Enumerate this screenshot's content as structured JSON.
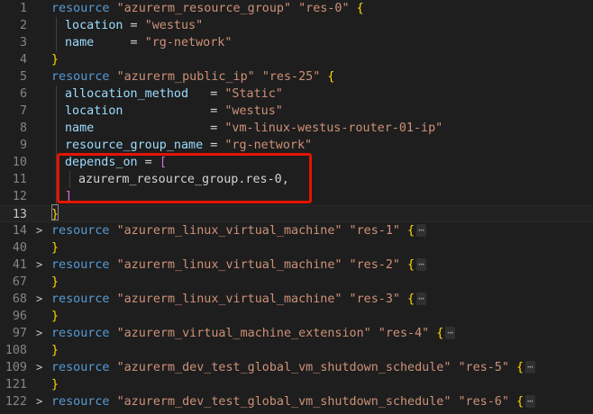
{
  "editor": {
    "language": "hcl",
    "active_line": "13",
    "fold_ellipsis": "⋯",
    "lines": [
      {
        "num": "1",
        "indent": 0,
        "fold": "",
        "tokens": [
          {
            "t": "resource",
            "c": "kw"
          },
          {
            "t": " ",
            "c": "plain"
          },
          {
            "t": "\"azurerm_resource_group\"",
            "c": "str"
          },
          {
            "t": " ",
            "c": "plain"
          },
          {
            "t": "\"res-0\"",
            "c": "str"
          },
          {
            "t": " ",
            "c": "plain"
          },
          {
            "t": "{",
            "c": "brace"
          }
        ]
      },
      {
        "num": "2",
        "indent": 1,
        "fold": "",
        "tokens": [
          {
            "t": "location",
            "c": "attr"
          },
          {
            "t": " = ",
            "c": "plain"
          },
          {
            "t": "\"westus\"",
            "c": "str"
          }
        ]
      },
      {
        "num": "3",
        "indent": 1,
        "fold": "",
        "tokens": [
          {
            "t": "name",
            "c": "attr"
          },
          {
            "t": "     = ",
            "c": "plain"
          },
          {
            "t": "\"rg-network\"",
            "c": "str"
          }
        ]
      },
      {
        "num": "4",
        "indent": 0,
        "fold": "",
        "tokens": [
          {
            "t": "}",
            "c": "brace"
          }
        ]
      },
      {
        "num": "5",
        "indent": 0,
        "fold": "",
        "tokens": [
          {
            "t": "resource",
            "c": "kw"
          },
          {
            "t": " ",
            "c": "plain"
          },
          {
            "t": "\"azurerm_public_ip\"",
            "c": "str"
          },
          {
            "t": " ",
            "c": "plain"
          },
          {
            "t": "\"res-25\"",
            "c": "str"
          },
          {
            "t": " ",
            "c": "plain"
          },
          {
            "t": "{",
            "c": "brace"
          }
        ]
      },
      {
        "num": "6",
        "indent": 1,
        "fold": "",
        "tokens": [
          {
            "t": "allocation_method",
            "c": "attr"
          },
          {
            "t": "   = ",
            "c": "plain"
          },
          {
            "t": "\"Static\"",
            "c": "str"
          }
        ]
      },
      {
        "num": "7",
        "indent": 1,
        "fold": "",
        "tokens": [
          {
            "t": "location",
            "c": "attr"
          },
          {
            "t": "            = ",
            "c": "plain"
          },
          {
            "t": "\"westus\"",
            "c": "str"
          }
        ]
      },
      {
        "num": "8",
        "indent": 1,
        "fold": "",
        "tokens": [
          {
            "t": "name",
            "c": "attr"
          },
          {
            "t": "                = ",
            "c": "plain"
          },
          {
            "t": "\"vm-linux-westus-router-01-ip\"",
            "c": "str"
          }
        ]
      },
      {
        "num": "9",
        "indent": 1,
        "fold": "",
        "tokens": [
          {
            "t": "resource_group_name",
            "c": "attr"
          },
          {
            "t": " = ",
            "c": "plain"
          },
          {
            "t": "\"rg-network\"",
            "c": "str"
          }
        ]
      },
      {
        "num": "10",
        "indent": 1,
        "fold": "",
        "tokens": [
          {
            "t": "depends_on",
            "c": "attr"
          },
          {
            "t": " = ",
            "c": "plain"
          },
          {
            "t": "[",
            "c": "bracket"
          }
        ]
      },
      {
        "num": "11",
        "indent": 2,
        "fold": "",
        "tokens": [
          {
            "t": "azurerm_resource_group.res-0,",
            "c": "plain"
          }
        ]
      },
      {
        "num": "12",
        "indent": 1,
        "fold": "",
        "tokens": [
          {
            "t": "]",
            "c": "bracket"
          }
        ]
      },
      {
        "num": "13",
        "indent": 0,
        "fold": "",
        "tokens": [
          {
            "t": "}",
            "c": "brace"
          }
        ]
      },
      {
        "num": "14",
        "indent": 0,
        "fold": ">",
        "tokens": [
          {
            "t": "resource",
            "c": "kw"
          },
          {
            "t": " ",
            "c": "plain"
          },
          {
            "t": "\"azurerm_linux_virtual_machine\"",
            "c": "str"
          },
          {
            "t": " ",
            "c": "plain"
          },
          {
            "t": "\"res-1\"",
            "c": "str"
          },
          {
            "t": " ",
            "c": "plain"
          },
          {
            "t": "{",
            "c": "brace"
          }
        ],
        "ellipsis": true
      },
      {
        "num": "40",
        "indent": 0,
        "fold": "",
        "tokens": [
          {
            "t": "}",
            "c": "brace"
          }
        ]
      },
      {
        "num": "41",
        "indent": 0,
        "fold": ">",
        "tokens": [
          {
            "t": "resource",
            "c": "kw"
          },
          {
            "t": " ",
            "c": "plain"
          },
          {
            "t": "\"azurerm_linux_virtual_machine\"",
            "c": "str"
          },
          {
            "t": " ",
            "c": "plain"
          },
          {
            "t": "\"res-2\"",
            "c": "str"
          },
          {
            "t": " ",
            "c": "plain"
          },
          {
            "t": "{",
            "c": "brace"
          }
        ],
        "ellipsis": true
      },
      {
        "num": "67",
        "indent": 0,
        "fold": "",
        "tokens": [
          {
            "t": "}",
            "c": "brace"
          }
        ]
      },
      {
        "num": "68",
        "indent": 0,
        "fold": ">",
        "tokens": [
          {
            "t": "resource",
            "c": "kw"
          },
          {
            "t": " ",
            "c": "plain"
          },
          {
            "t": "\"azurerm_linux_virtual_machine\"",
            "c": "str"
          },
          {
            "t": " ",
            "c": "plain"
          },
          {
            "t": "\"res-3\"",
            "c": "str"
          },
          {
            "t": " ",
            "c": "plain"
          },
          {
            "t": "{",
            "c": "brace"
          }
        ],
        "ellipsis": true
      },
      {
        "num": "96",
        "indent": 0,
        "fold": "",
        "tokens": [
          {
            "t": "}",
            "c": "brace"
          }
        ]
      },
      {
        "num": "97",
        "indent": 0,
        "fold": ">",
        "tokens": [
          {
            "t": "resource",
            "c": "kw"
          },
          {
            "t": " ",
            "c": "plain"
          },
          {
            "t": "\"azurerm_virtual_machine_extension\"",
            "c": "str"
          },
          {
            "t": " ",
            "c": "plain"
          },
          {
            "t": "\"res-4\"",
            "c": "str"
          },
          {
            "t": " ",
            "c": "plain"
          },
          {
            "t": "{",
            "c": "brace"
          }
        ],
        "ellipsis": true
      },
      {
        "num": "108",
        "indent": 0,
        "fold": "",
        "tokens": [
          {
            "t": "}",
            "c": "brace"
          }
        ]
      },
      {
        "num": "109",
        "indent": 0,
        "fold": ">",
        "tokens": [
          {
            "t": "resource",
            "c": "kw"
          },
          {
            "t": " ",
            "c": "plain"
          },
          {
            "t": "\"azurerm_dev_test_global_vm_shutdown_schedule\"",
            "c": "str"
          },
          {
            "t": " ",
            "c": "plain"
          },
          {
            "t": "\"res-5\"",
            "c": "str"
          },
          {
            "t": " ",
            "c": "plain"
          },
          {
            "t": "{",
            "c": "brace"
          }
        ],
        "ellipsis": true
      },
      {
        "num": "121",
        "indent": 0,
        "fold": "",
        "tokens": [
          {
            "t": "}",
            "c": "brace"
          }
        ]
      },
      {
        "num": "122",
        "indent": 0,
        "fold": ">",
        "tokens": [
          {
            "t": "resource",
            "c": "kw"
          },
          {
            "t": " ",
            "c": "plain"
          },
          {
            "t": "\"azurerm_dev_test_global_vm_shutdown_schedule\"",
            "c": "str"
          },
          {
            "t": " ",
            "c": "plain"
          },
          {
            "t": "\"res-6\"",
            "c": "str"
          },
          {
            "t": " ",
            "c": "plain"
          },
          {
            "t": "{",
            "c": "brace"
          }
        ],
        "ellipsis": true
      }
    ]
  },
  "colors": {
    "background": "#1e1e1e",
    "keyword": "#569cd6",
    "string": "#ce9178",
    "attribute": "#9cdcfe",
    "bracket_gold": "#ffd700",
    "bracket_purple": "#da70d6",
    "annotation_box": "#e51400"
  },
  "annotation": {
    "type": "red-rectangle",
    "target_lines": [
      "10",
      "11",
      "12"
    ]
  }
}
